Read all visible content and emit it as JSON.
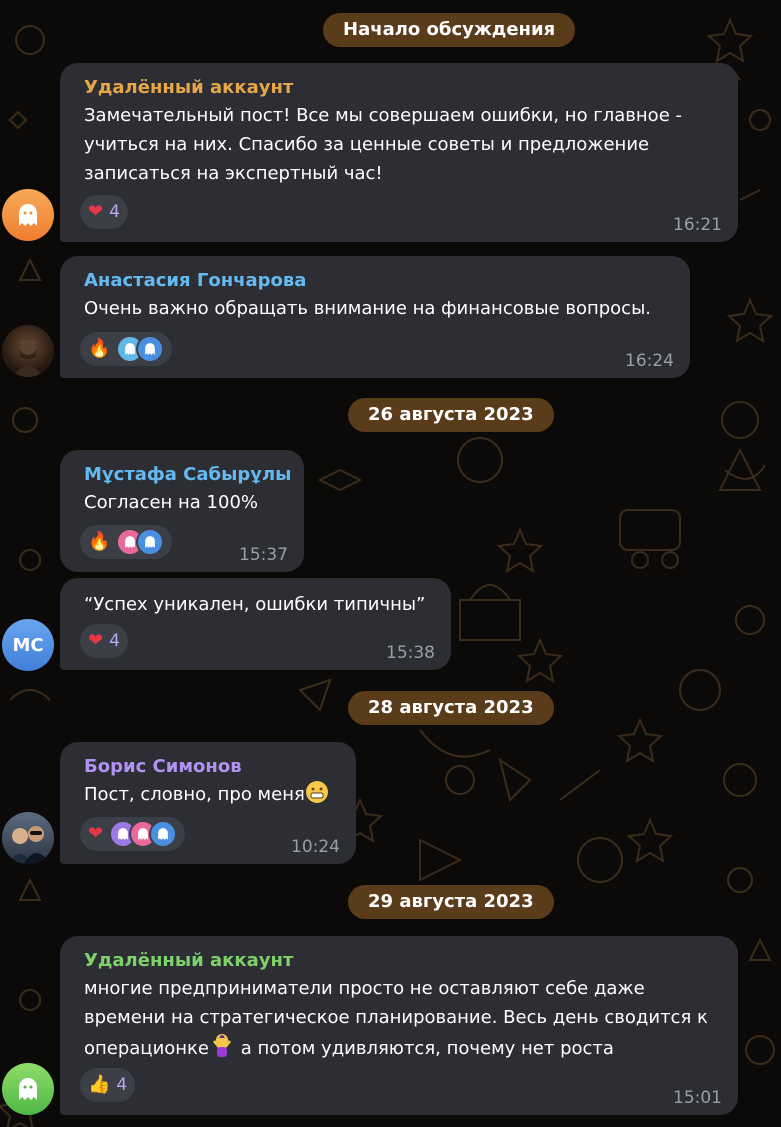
{
  "separators": {
    "start": "Начало обсуждения",
    "d1": "26 августа 2023",
    "d2": "28 августа 2023",
    "d3": "29 августа 2023"
  },
  "messages": [
    {
      "author": "Удалённый аккаунт",
      "author_color": "#e8a64a",
      "lines": [
        "Замечательный пост! Все мы совершаем ошибки, но главное -",
        "учиться на них. Спасибо за ценные советы и предложение",
        "записаться на экспертный час!"
      ],
      "reaction": {
        "emoji": "heart-icon",
        "count": "4"
      },
      "time": "16:21",
      "avatar": "ghost-avatar-orange"
    },
    {
      "author": "Анастасия Гончарова",
      "author_color": "#64b9f0",
      "lines": [
        "Очень важно обращать внимание на финансовые вопросы."
      ],
      "reaction": {
        "emoji": "fire-icon"
      },
      "time": "16:24",
      "avatar": "photo-avatar"
    },
    {
      "author": "Мұстафа Сабырұлы",
      "author_color": "#64b9f0",
      "lines": [
        "Согласен на 100%"
      ],
      "reaction": {
        "emoji": "fire-icon"
      },
      "time": "15:37"
    },
    {
      "lines": [
        "“Успех уникален, ошибки типичны”"
      ],
      "reaction": {
        "emoji": "heart-icon",
        "count": "4"
      },
      "time": "15:38",
      "avatar": "MC"
    },
    {
      "author": "Борис Симонов",
      "author_color": "#b191f2",
      "lines": [
        "Пост, словно, про меня"
      ],
      "reaction": {
        "emoji": "heart-icon"
      },
      "time": "10:24",
      "avatar": "photo-avatar"
    },
    {
      "author": "Удалённый аккаунт",
      "author_color": "#7fd16a",
      "lines": [
        "многие предприниматели просто не оставляют себе даже",
        "времени на стратегическое планирование. Весь день сводится к",
        "операционке",
        " а потом удивляются, почему нет роста"
      ],
      "reaction": {
        "emoji": "thumbs-up-icon",
        "count": "4"
      },
      "time": "15:01",
      "avatar": "ghost-avatar-green"
    }
  ]
}
